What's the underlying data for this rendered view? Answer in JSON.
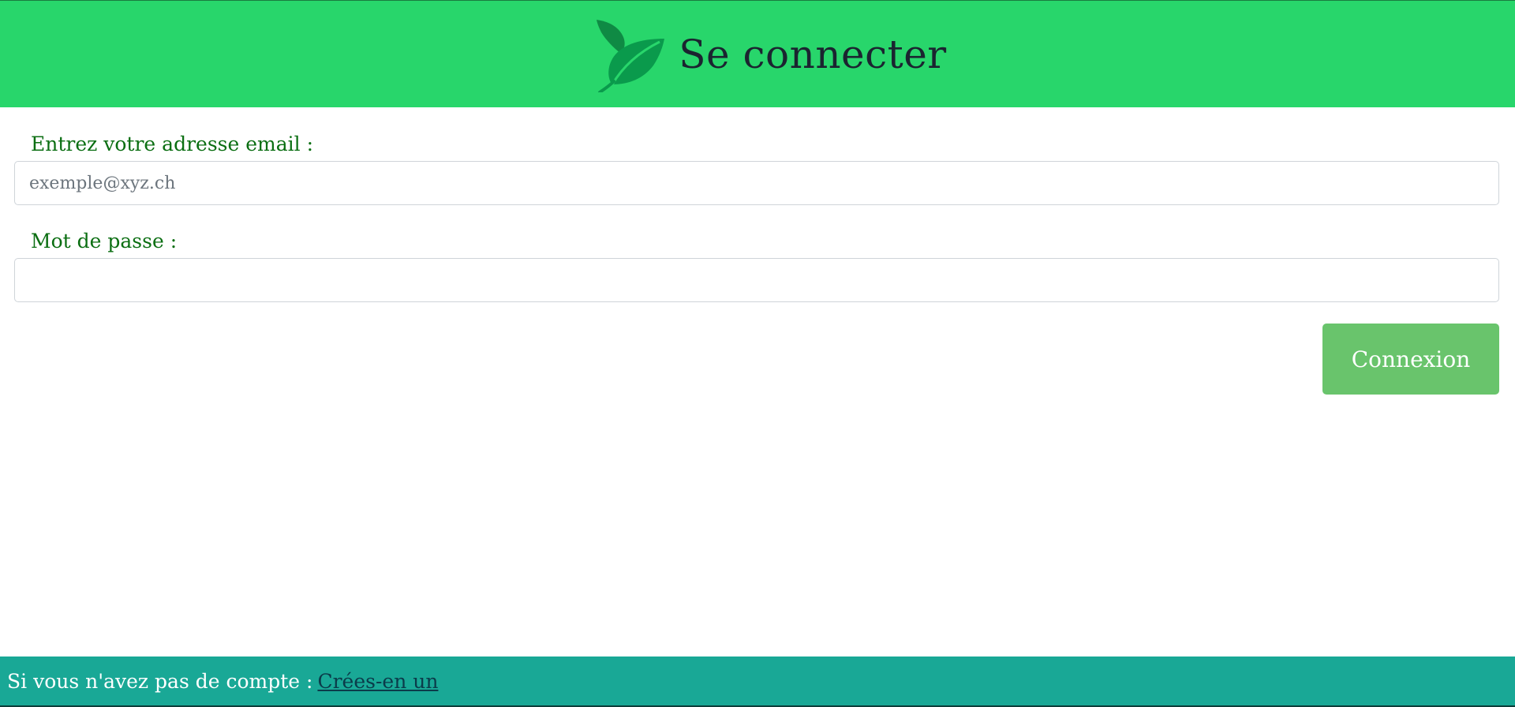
{
  "header": {
    "title": "Se connecter",
    "logo_icon": "leaf-icon",
    "background_color": "#28d66b"
  },
  "form": {
    "email_label": "Entrez votre adresse email :",
    "email_placeholder": "exemple@xyz.ch",
    "email_value": "",
    "password_label": "Mot de passe :",
    "password_value": "",
    "submit_label": "Connexion",
    "label_color": "#0b6e12",
    "submit_color": "#69c46c"
  },
  "footer": {
    "text": "Si vous n'avez pas de compte :",
    "link_label": "Crées-en un",
    "background_color": "#19a896"
  }
}
